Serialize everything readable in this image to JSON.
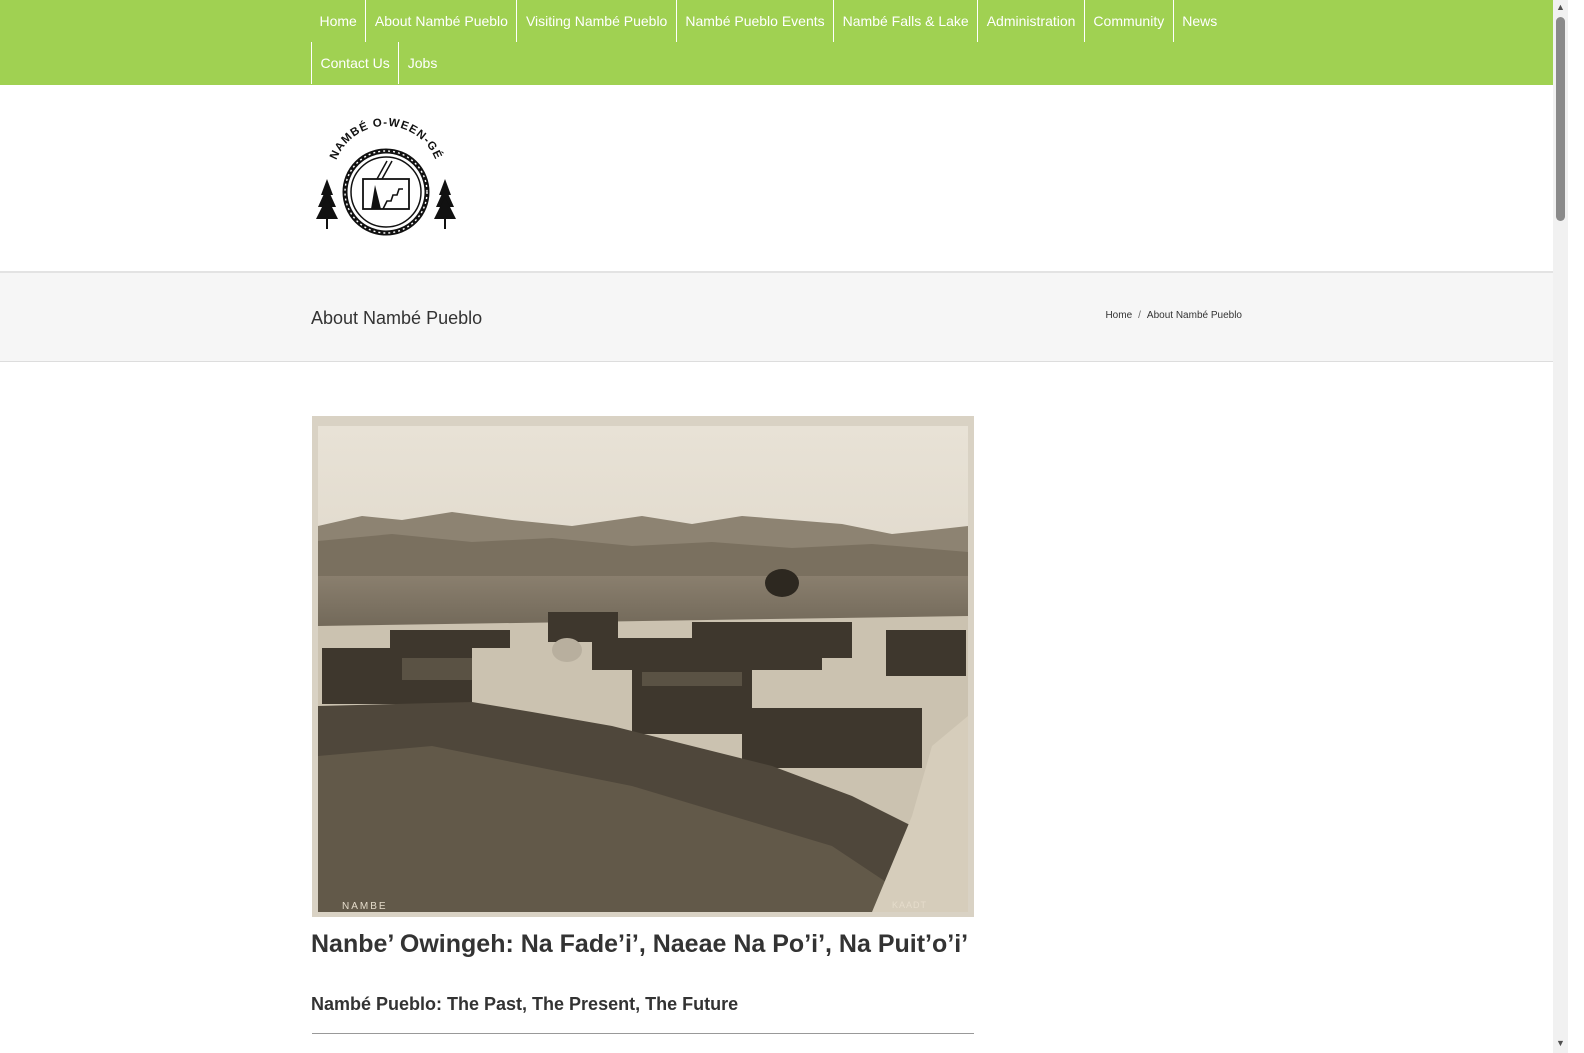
{
  "nav": {
    "row1": [
      "Home",
      "About Nambé Pueblo",
      "Visiting Nambé Pueblo",
      "Nambé Pueblo Events",
      "Nambé Falls & Lake",
      "Administration",
      "Community",
      "News"
    ],
    "row2": [
      "Contact Us",
      "Jobs"
    ]
  },
  "logo": {
    "text": "NAMBÉ O-WEEN-GÉ"
  },
  "titlebar": {
    "title": "About Nambé Pueblo",
    "breadcrumb": {
      "home": "Home",
      "separator": "/",
      "current": "About Nambé Pueblo"
    }
  },
  "hero": {
    "caption_left": "NAMBE",
    "caption_right": "KAADT"
  },
  "article": {
    "title": "Nanbe’ Owingeh: Na Fade’i’, Naeae Na Po’i’, Na Puit’o’i’",
    "subtitle": "Nambé Pueblo: The Past, The Present, The Future"
  },
  "colors": {
    "nav_bg": "#a0d152",
    "titlebar_bg": "#f6f6f6"
  }
}
